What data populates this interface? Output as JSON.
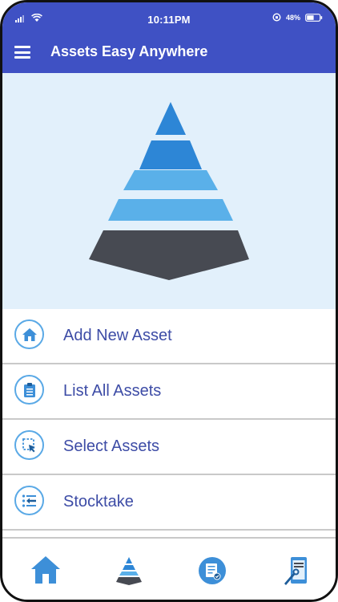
{
  "status_bar": {
    "time": "10:11PM",
    "battery": "48%",
    "icons": [
      "signal-icon",
      "wifi-icon",
      "orientation-lock-icon",
      "battery-icon"
    ]
  },
  "header": {
    "title": "Assets Easy Anywhere",
    "menu_icon": "hamburger-icon"
  },
  "colors": {
    "header_bg": "#3f51c4",
    "hero_bg": "#e2f0fb",
    "accent": "#5aa9e6",
    "label_text": "#3d4ca6"
  },
  "menu": {
    "items": [
      {
        "label": "Add New Asset",
        "icon": "home-icon"
      },
      {
        "label": "List All Assets",
        "icon": "clipboard-icon"
      },
      {
        "label": "Select Assets",
        "icon": "select-cursor-icon"
      },
      {
        "label": "Stocktake",
        "icon": "list-arrow-icon"
      }
    ]
  },
  "tab_bar": {
    "tabs": [
      {
        "icon": "home-tab-icon"
      },
      {
        "icon": "pyramid-tab-icon"
      },
      {
        "icon": "checklist-tab-icon"
      },
      {
        "icon": "device-tools-tab-icon"
      }
    ]
  }
}
